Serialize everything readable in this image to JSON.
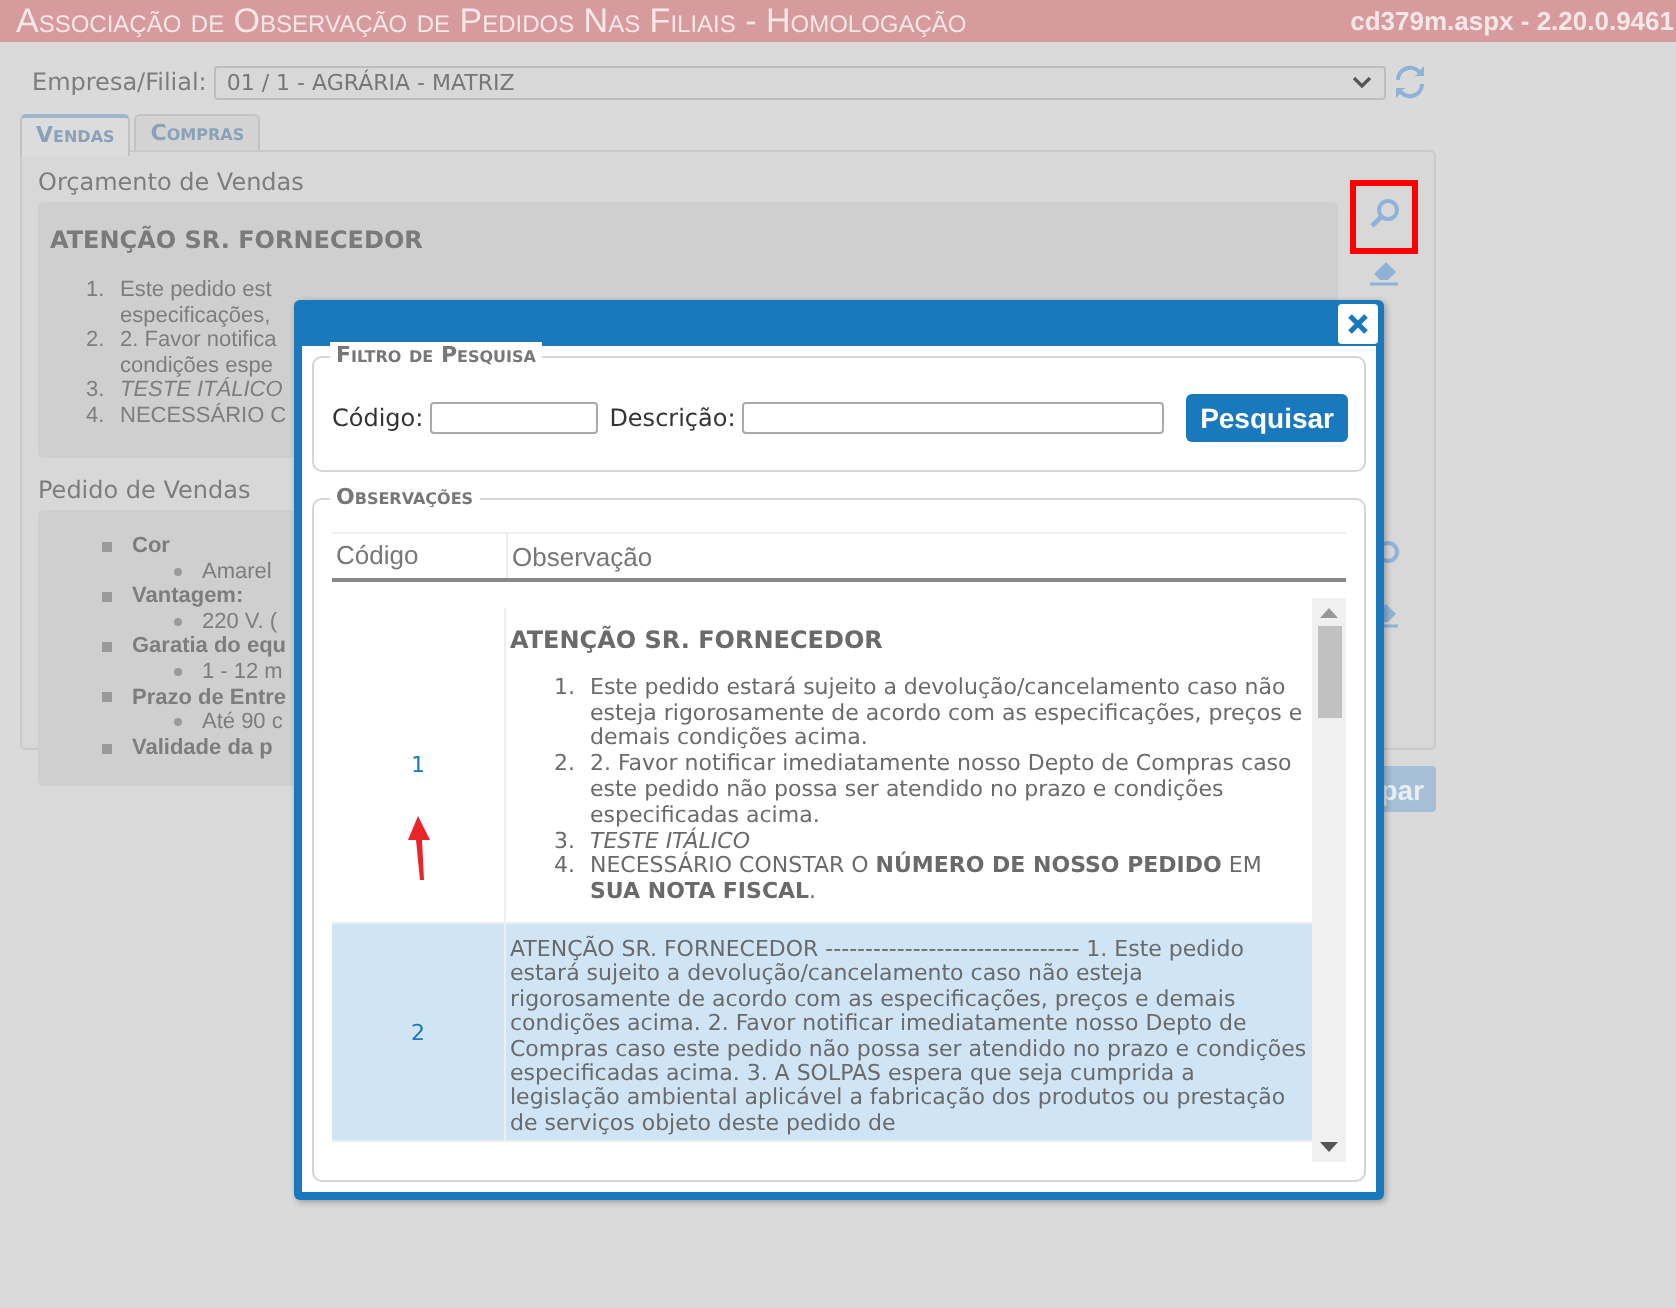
{
  "title_bar": {
    "title": "Associação de Observação de Pedidos Nas Filiais  - Homologação",
    "version": "cd379m.aspx - 2.20.0.9461"
  },
  "company": {
    "label": "Empresa/Filial:",
    "value": "01 / 1 - AGRÁRIA - MATRIZ"
  },
  "tabs": [
    {
      "label": "Vendas",
      "selected": true
    },
    {
      "label": "Compras",
      "selected": false
    }
  ],
  "sections": [
    {
      "label": "Orçamento de Vendas",
      "heading": "ATENÇÃO SR. FORNECEDOR",
      "lines": [
        {
          "kind": "numbered",
          "marker": "1.",
          "text": "Este pedido est"
        },
        {
          "kind": "continued",
          "text": "especificações,"
        },
        {
          "kind": "numbered",
          "marker": "2.",
          "text": "2. Favor notifica"
        },
        {
          "kind": "continued",
          "text": "condições espe"
        },
        {
          "kind": "italic",
          "marker": "3.",
          "text": "TESTE ITÁLICO"
        },
        {
          "kind": "numbered",
          "marker": "4.",
          "text": "NECESSÁRIO C"
        }
      ]
    },
    {
      "label": "Pedido de Vendas",
      "lines": [
        {
          "kind": "bullet",
          "text": "Cor"
        },
        {
          "kind": "sub",
          "text": "Amarel"
        },
        {
          "kind": "bullet",
          "text": "Vantagem:"
        },
        {
          "kind": "sub",
          "text": "220 V. ("
        },
        {
          "kind": "bullet",
          "text": "Garatia do equ"
        },
        {
          "kind": "sub",
          "text": "1 - 12 m"
        },
        {
          "kind": "bullet",
          "text": "Prazo de Entre"
        },
        {
          "kind": "sub",
          "text": "Até 90 c"
        },
        {
          "kind": "bullet",
          "text": "Validade da p"
        }
      ]
    }
  ],
  "tools": [
    {
      "highlighted": true
    },
    {
      "highlighted": false
    }
  ],
  "clear_button": "par",
  "modal": {
    "filter": {
      "legend": "Filtro de Pesquisa",
      "fields": [
        {
          "label": "Código:"
        },
        {
          "label": "Descrição:"
        }
      ],
      "button": "Pesquisar"
    },
    "results": {
      "legend": "Observações",
      "columns": [
        "Código",
        "Observação"
      ],
      "rows": [
        {
          "code": "1",
          "selected": false,
          "kind": "formatted",
          "heading": "ATENÇÃO SR. FORNECEDOR",
          "items": [
            {
              "kind": "plain",
              "marker": "1.",
              "text": "Este pedido estará sujeito a devolução/cancelamento caso não esteja rigorosamente de acordo com as especificações, preços e demais condições acima."
            },
            {
              "kind": "plain",
              "marker": "2.",
              "text": "2. Favor notificar imediatamente nosso Depto de Compras caso este pedido não possa ser atendido no prazo e condições especificadas acima."
            },
            {
              "kind": "italic",
              "marker": "3.",
              "text": "TESTE ITÁLICO"
            },
            {
              "kind": "plain",
              "marker": "4.",
              "text": "NECESSÁRIO CONSTAR O **NÚMERO DE NOSSO PEDIDO** EM **SUA NOTA FISCAL**."
            }
          ]
        },
        {
          "code": "2",
          "selected": true,
          "kind": "plain",
          "text": "ATENÇÃO SR. FORNECEDOR -------------------------------- 1. Este pedido estará sujeito a devolução/cancelamento caso não esteja rigorosamente de acordo com as especificações, preços e demais condições acima. 2. Favor notificar imediatamente nosso Depto de Compras caso este pedido não possa ser atendido no prazo e condições especificadas acima. 3. A SOLPAS espera que seja cumprida a legislação ambiental aplicável a fabricação dos produtos ou prestação de serviços objeto deste pedido de"
        }
      ]
    }
  }
}
